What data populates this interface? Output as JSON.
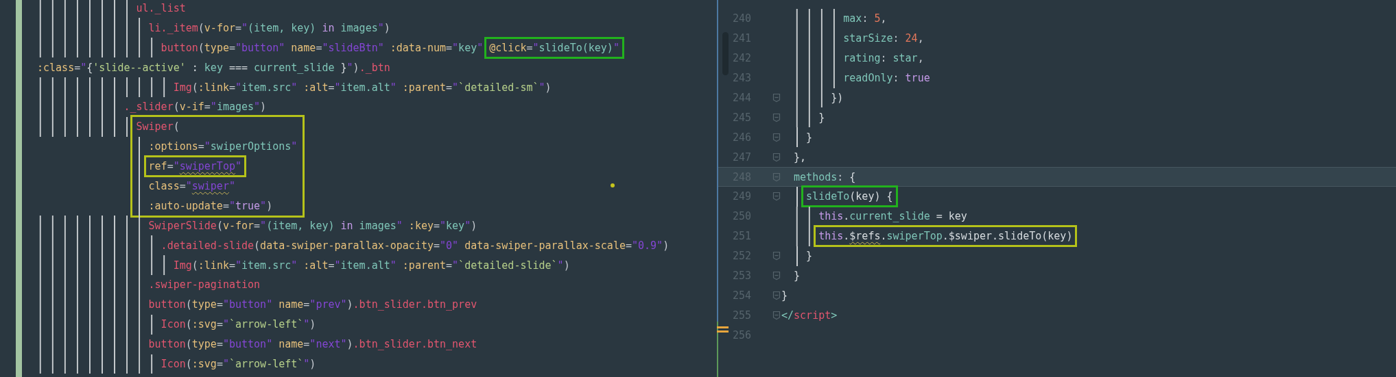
{
  "left_editor": {
    "lines": [
      {
        "kind": "line",
        "segments": [
          {
            "tokens": [
              {
                "kind": "tag",
                "text": "                ul._list"
              }
            ]
          }
        ]
      },
      {
        "kind": "line",
        "segments": [
          {
            "tokens": [
              {
                "kind": "tag",
                "text": "                  li._item"
              },
              {
                "kind": "p",
                "text": "("
              },
              {
                "kind": "at",
                "text": "v-for"
              },
              {
                "kind": "p",
                "text": "="
              },
              {
                "kind": "q",
                "text": "\""
              },
              {
                "kind": "e",
                "text": "(item, key) "
              },
              {
                "kind": "k",
                "text": "in"
              },
              {
                "kind": "e",
                "text": " images"
              },
              {
                "kind": "q",
                "text": "\""
              },
              {
                "kind": "p",
                "text": ")"
              }
            ]
          }
        ]
      },
      {
        "kind": "line",
        "segments": [
          {
            "tokens": [
              {
                "kind": "tag",
                "text": "                    button"
              },
              {
                "kind": "p",
                "text": "("
              },
              {
                "kind": "at",
                "text": "type"
              },
              {
                "kind": "p",
                "text": "="
              },
              {
                "kind": "q",
                "text": "\""
              },
              {
                "kind": "s",
                "text": "button"
              },
              {
                "kind": "q",
                "text": "\""
              },
              {
                "kind": "at",
                "text": " name"
              },
              {
                "kind": "p",
                "text": "="
              },
              {
                "kind": "q",
                "text": "\""
              },
              {
                "kind": "s",
                "text": "slideBtn"
              },
              {
                "kind": "q",
                "text": "\""
              },
              {
                "kind": "at",
                "text": " :data-num"
              },
              {
                "kind": "p",
                "text": "="
              },
              {
                "kind": "q",
                "text": "\""
              },
              {
                "kind": "e",
                "text": "key"
              },
              {
                "kind": "q",
                "text": "\" "
              }
            ]
          },
          {
            "color": "#22b21d",
            "tokens": [
              {
                "kind": "at",
                "text": "@click"
              },
              {
                "kind": "p",
                "text": "="
              },
              {
                "kind": "q",
                "text": "\""
              },
              {
                "kind": "e",
                "text": "slideTo(key)"
              },
              {
                "kind": "q",
                "text": "\""
              }
            ]
          }
        ]
      },
      {
        "kind": "line",
        "segments": [
          {
            "tokens": [
              {
                "kind": "at",
                "text": ":class"
              },
              {
                "kind": "p",
                "text": "="
              },
              {
                "kind": "q",
                "text": "\""
              },
              {
                "kind": "w",
                "text": "{"
              },
              {
                "kind": "t",
                "text": "'slide--active'"
              },
              {
                "kind": "w",
                "text": " : "
              },
              {
                "kind": "e",
                "text": "key"
              },
              {
                "kind": "w",
                "text": " === "
              },
              {
                "kind": "e",
                "text": "current_slide"
              },
              {
                "kind": "w",
                "text": " }"
              },
              {
                "kind": "q",
                "text": "\""
              },
              {
                "kind": "p",
                "text": ")"
              },
              {
                "kind": "tag",
                "text": "._btn"
              }
            ]
          }
        ]
      },
      {
        "kind": "line",
        "segments": [
          {
            "tokens": [
              {
                "kind": "tag",
                "text": "                      Img"
              },
              {
                "kind": "p",
                "text": "("
              },
              {
                "kind": "at",
                "text": ":link"
              },
              {
                "kind": "p",
                "text": "="
              },
              {
                "kind": "q",
                "text": "\""
              },
              {
                "kind": "e",
                "text": "item.src"
              },
              {
                "kind": "q",
                "text": "\""
              },
              {
                "kind": "at",
                "text": " :alt"
              },
              {
                "kind": "p",
                "text": "="
              },
              {
                "kind": "q",
                "text": "\""
              },
              {
                "kind": "e",
                "text": "item.alt"
              },
              {
                "kind": "q",
                "text": "\""
              },
              {
                "kind": "at",
                "text": " :parent"
              },
              {
                "kind": "p",
                "text": "="
              },
              {
                "kind": "q",
                "text": "\""
              },
              {
                "kind": "t",
                "text": "`detailed-sm`"
              },
              {
                "kind": "q",
                "text": "\""
              },
              {
                "kind": "p",
                "text": ")"
              }
            ]
          }
        ]
      },
      {
        "kind": "line",
        "segments": [
          {
            "tokens": [
              {
                "kind": "tag",
                "text": "              ._slider"
              },
              {
                "kind": "p",
                "text": "("
              },
              {
                "kind": "at",
                "text": "v-if"
              },
              {
                "kind": "p",
                "text": "="
              },
              {
                "kind": "q",
                "text": "\""
              },
              {
                "kind": "e",
                "text": "images"
              },
              {
                "kind": "q",
                "text": "\""
              },
              {
                "kind": "p",
                "text": ")"
              }
            ]
          }
        ]
      },
      {
        "kind": "block",
        "color": "#b5c21a",
        "lines": [
          {
            "kind": "line",
            "segments": [
              {
                "tokens": [
                  {
                    "kind": "tag",
                    "text": "                Swiper"
                  },
                  {
                    "kind": "p",
                    "text": "("
                  }
                ]
              }
            ]
          },
          {
            "kind": "line",
            "segments": [
              {
                "tokens": [
                  {
                    "kind": "at",
                    "text": "                  :options"
                  },
                  {
                    "kind": "p",
                    "text": "="
                  },
                  {
                    "kind": "q",
                    "text": "\""
                  },
                  {
                    "kind": "e",
                    "text": "swiperOptions"
                  },
                  {
                    "kind": "q",
                    "text": "\""
                  }
                ]
              }
            ]
          },
          {
            "kind": "line",
            "segments": [
              {
                "color": "#b5c21a",
                "tokens": [
                  {
                    "kind": "at",
                    "text": "                  ref"
                  },
                  {
                    "kind": "p",
                    "text": "="
                  },
                  {
                    "kind": "q",
                    "text": "\""
                  },
                  {
                    "kind": "s",
                    "text": "swiperTop",
                    "misspelled": true
                  },
                  {
                    "kind": "q",
                    "text": "\""
                  }
                ]
              }
            ]
          },
          {
            "kind": "line",
            "segments": [
              {
                "tokens": [
                  {
                    "kind": "at",
                    "text": "                  class"
                  },
                  {
                    "kind": "p",
                    "text": "="
                  },
                  {
                    "kind": "q",
                    "text": "\""
                  },
                  {
                    "kind": "s",
                    "text": "swiper",
                    "misspelled": true
                  },
                  {
                    "kind": "q",
                    "text": "\""
                  }
                ]
              }
            ]
          },
          {
            "kind": "line",
            "segments": [
              {
                "tokens": [
                  {
                    "kind": "at",
                    "text": "                  :auto-update"
                  },
                  {
                    "kind": "p",
                    "text": "="
                  },
                  {
                    "kind": "q",
                    "text": "\""
                  },
                  {
                    "kind": "k",
                    "text": "true"
                  },
                  {
                    "kind": "q",
                    "text": "\""
                  },
                  {
                    "kind": "p",
                    "text": ")"
                  }
                ]
              }
            ]
          }
        ]
      },
      {
        "kind": "line",
        "segments": [
          {
            "tokens": [
              {
                "kind": "tag",
                "text": "                  SwiperSlide"
              },
              {
                "kind": "p",
                "text": "("
              },
              {
                "kind": "at",
                "text": "v-for"
              },
              {
                "kind": "p",
                "text": "="
              },
              {
                "kind": "q",
                "text": "\""
              },
              {
                "kind": "e",
                "text": "(item, key) "
              },
              {
                "kind": "k",
                "text": "in"
              },
              {
                "kind": "e",
                "text": " images"
              },
              {
                "kind": "q",
                "text": "\""
              },
              {
                "kind": "at",
                "text": " :key"
              },
              {
                "kind": "p",
                "text": "="
              },
              {
                "kind": "q",
                "text": "\""
              },
              {
                "kind": "e",
                "text": "key"
              },
              {
                "kind": "q",
                "text": "\""
              },
              {
                "kind": "p",
                "text": ")"
              }
            ]
          }
        ]
      },
      {
        "kind": "line",
        "segments": [
          {
            "tokens": [
              {
                "kind": "tag",
                "text": "                    .detailed-slide"
              },
              {
                "kind": "p",
                "text": "("
              },
              {
                "kind": "at",
                "text": "data-swiper-parallax-opacity"
              },
              {
                "kind": "p",
                "text": "="
              },
              {
                "kind": "q",
                "text": "\""
              },
              {
                "kind": "s",
                "text": "0"
              },
              {
                "kind": "q",
                "text": "\""
              },
              {
                "kind": "at",
                "text": " data-swiper-parallax-scale"
              },
              {
                "kind": "p",
                "text": "="
              },
              {
                "kind": "q",
                "text": "\""
              },
              {
                "kind": "s",
                "text": "0.9"
              },
              {
                "kind": "q",
                "text": "\""
              },
              {
                "kind": "p",
                "text": ")"
              }
            ]
          }
        ]
      },
      {
        "kind": "line",
        "segments": [
          {
            "tokens": [
              {
                "kind": "tag",
                "text": "                      Img"
              },
              {
                "kind": "p",
                "text": "("
              },
              {
                "kind": "at",
                "text": ":link"
              },
              {
                "kind": "p",
                "text": "="
              },
              {
                "kind": "q",
                "text": "\""
              },
              {
                "kind": "e",
                "text": "item.src"
              },
              {
                "kind": "q",
                "text": "\""
              },
              {
                "kind": "at",
                "text": " :alt"
              },
              {
                "kind": "p",
                "text": "="
              },
              {
                "kind": "q",
                "text": "\""
              },
              {
                "kind": "e",
                "text": "item.alt"
              },
              {
                "kind": "q",
                "text": "\""
              },
              {
                "kind": "at",
                "text": " :parent"
              },
              {
                "kind": "p",
                "text": "="
              },
              {
                "kind": "q",
                "text": "\""
              },
              {
                "kind": "t",
                "text": "`detailed-slide`"
              },
              {
                "kind": "q",
                "text": "\""
              },
              {
                "kind": "p",
                "text": ")"
              }
            ]
          }
        ]
      },
      {
        "kind": "line",
        "segments": [
          {
            "tokens": [
              {
                "kind": "tag",
                "text": "                  .swiper-pagination"
              }
            ]
          }
        ]
      },
      {
        "kind": "line",
        "segments": [
          {
            "tokens": [
              {
                "kind": "tag",
                "text": "                  button"
              },
              {
                "kind": "p",
                "text": "("
              },
              {
                "kind": "at",
                "text": "type"
              },
              {
                "kind": "p",
                "text": "="
              },
              {
                "kind": "q",
                "text": "\""
              },
              {
                "kind": "s",
                "text": "button"
              },
              {
                "kind": "q",
                "text": "\""
              },
              {
                "kind": "at",
                "text": " name"
              },
              {
                "kind": "p",
                "text": "="
              },
              {
                "kind": "q",
                "text": "\""
              },
              {
                "kind": "s",
                "text": "prev"
              },
              {
                "kind": "q",
                "text": "\""
              },
              {
                "kind": "p",
                "text": ")"
              },
              {
                "kind": "tag",
                "text": ".btn_slider.btn_prev"
              }
            ]
          }
        ]
      },
      {
        "kind": "line",
        "segments": [
          {
            "tokens": [
              {
                "kind": "tag",
                "text": "                    Icon"
              },
              {
                "kind": "p",
                "text": "("
              },
              {
                "kind": "at",
                "text": ":svg"
              },
              {
                "kind": "p",
                "text": "="
              },
              {
                "kind": "q",
                "text": "\""
              },
              {
                "kind": "t",
                "text": "`arrow-left`"
              },
              {
                "kind": "q",
                "text": "\""
              },
              {
                "kind": "p",
                "text": ")"
              }
            ]
          }
        ]
      },
      {
        "kind": "line",
        "segments": [
          {
            "tokens": [
              {
                "kind": "tag",
                "text": "                  button"
              },
              {
                "kind": "p",
                "text": "("
              },
              {
                "kind": "at",
                "text": "type"
              },
              {
                "kind": "p",
                "text": "="
              },
              {
                "kind": "q",
                "text": "\""
              },
              {
                "kind": "s",
                "text": "button"
              },
              {
                "kind": "q",
                "text": "\""
              },
              {
                "kind": "at",
                "text": " name"
              },
              {
                "kind": "p",
                "text": "="
              },
              {
                "kind": "q",
                "text": "\""
              },
              {
                "kind": "s",
                "text": "next"
              },
              {
                "kind": "q",
                "text": "\""
              },
              {
                "kind": "p",
                "text": ")"
              },
              {
                "kind": "tag",
                "text": ".btn_slider.btn_next"
              }
            ]
          }
        ]
      },
      {
        "kind": "line",
        "segments": [
          {
            "tokens": [
              {
                "kind": "tag",
                "text": "                    Icon"
              },
              {
                "kind": "p",
                "text": "("
              },
              {
                "kind": "at",
                "text": ":svg"
              },
              {
                "kind": "p",
                "text": "="
              },
              {
                "kind": "q",
                "text": "\""
              },
              {
                "kind": "t",
                "text": "`arrow-left`"
              },
              {
                "kind": "q",
                "text": "\""
              },
              {
                "kind": "p",
                "text": ")"
              }
            ]
          }
        ]
      }
    ]
  },
  "right_editor": {
    "lines": [
      {
        "number": "240",
        "fold": false,
        "current": false,
        "segments": [
          {
            "tokens": [
              {
                "kind": "pr",
                "text": "          max"
              },
              {
                "kind": "p",
                "text": ": "
              },
              {
                "kind": "n",
                "text": "5"
              },
              {
                "kind": "p",
                "text": ","
              }
            ]
          }
        ]
      },
      {
        "number": "241",
        "fold": false,
        "current": false,
        "segments": [
          {
            "tokens": [
              {
                "kind": "pr",
                "text": "          starSize"
              },
              {
                "kind": "p",
                "text": ": "
              },
              {
                "kind": "n",
                "text": "24"
              },
              {
                "kind": "p",
                "text": ","
              }
            ]
          }
        ]
      },
      {
        "number": "242",
        "fold": false,
        "current": false,
        "segments": [
          {
            "tokens": [
              {
                "kind": "pr",
                "text": "          rating"
              },
              {
                "kind": "p",
                "text": ": "
              },
              {
                "kind": "pr",
                "text": "star"
              },
              {
                "kind": "p",
                "text": ","
              }
            ]
          }
        ]
      },
      {
        "number": "243",
        "fold": false,
        "current": false,
        "segments": [
          {
            "tokens": [
              {
                "kind": "pr",
                "text": "          readOnly"
              },
              {
                "kind": "p",
                "text": ": "
              },
              {
                "kind": "k",
                "text": "true"
              }
            ]
          }
        ]
      },
      {
        "number": "244",
        "fold": true,
        "current": false,
        "segments": [
          {
            "tokens": [
              {
                "kind": "w",
                "text": "        })"
              }
            ]
          }
        ]
      },
      {
        "number": "245",
        "fold": true,
        "current": false,
        "segments": [
          {
            "tokens": [
              {
                "kind": "w",
                "text": "      }"
              }
            ]
          }
        ]
      },
      {
        "number": "246",
        "fold": true,
        "current": false,
        "segments": [
          {
            "tokens": [
              {
                "kind": "w",
                "text": "    }"
              }
            ]
          }
        ]
      },
      {
        "number": "247",
        "fold": true,
        "current": false,
        "segments": [
          {
            "tokens": [
              {
                "kind": "w",
                "text": "  },"
              }
            ]
          }
        ]
      },
      {
        "number": "248",
        "fold": true,
        "current": true,
        "segments": [
          {
            "tokens": [
              {
                "kind": "pr",
                "text": "  methods"
              },
              {
                "kind": "p",
                "text": ":"
              },
              {
                "kind": "w",
                "text": " {"
              }
            ]
          }
        ]
      },
      {
        "number": "249",
        "fold": true,
        "current": false,
        "segments": [
          {
            "color": "#22b21d",
            "tokens": [
              {
                "kind": "pr",
                "text": "    slideTo"
              },
              {
                "kind": "w",
                "text": "(key) {"
              }
            ]
          }
        ]
      },
      {
        "number": "250",
        "fold": false,
        "current": false,
        "segments": [
          {
            "tokens": [
              {
                "kind": "k",
                "text": "      this"
              },
              {
                "kind": "w",
                "text": "."
              },
              {
                "kind": "pr",
                "text": "current_slide"
              },
              {
                "kind": "w",
                "text": " = key"
              }
            ]
          }
        ]
      },
      {
        "number": "251",
        "fold": false,
        "current": false,
        "segments": [
          {
            "color": "#b5c21a",
            "tokens": [
              {
                "kind": "k",
                "text": "      this"
              },
              {
                "kind": "w",
                "text": "."
              },
              {
                "kind": "w",
                "text": "$refs",
                "misspelled": true
              },
              {
                "kind": "w",
                "text": "."
              },
              {
                "kind": "pr",
                "text": "swiperTop"
              },
              {
                "kind": "w",
                "text": ".$swiper.slideTo(key)"
              }
            ]
          }
        ]
      },
      {
        "number": "252",
        "fold": true,
        "current": false,
        "segments": [
          {
            "tokens": [
              {
                "kind": "w",
                "text": "    }"
              }
            ]
          }
        ]
      },
      {
        "number": "253",
        "fold": true,
        "current": false,
        "segments": [
          {
            "tokens": [
              {
                "kind": "w",
                "text": "  }"
              }
            ]
          }
        ]
      },
      {
        "number": "254",
        "fold": true,
        "current": false,
        "segments": [
          {
            "tokens": [
              {
                "kind": "w",
                "text": "}"
              }
            ]
          }
        ]
      },
      {
        "number": "255",
        "fold": true,
        "current": false,
        "segments": [
          {
            "tokens": [
              {
                "kind": "e",
                "text": "</"
              },
              {
                "kind": "tag",
                "text": "script"
              },
              {
                "kind": "e",
                "text": ">"
              }
            ]
          }
        ]
      },
      {
        "number": "256",
        "fold": false,
        "current": false
      }
    ]
  }
}
